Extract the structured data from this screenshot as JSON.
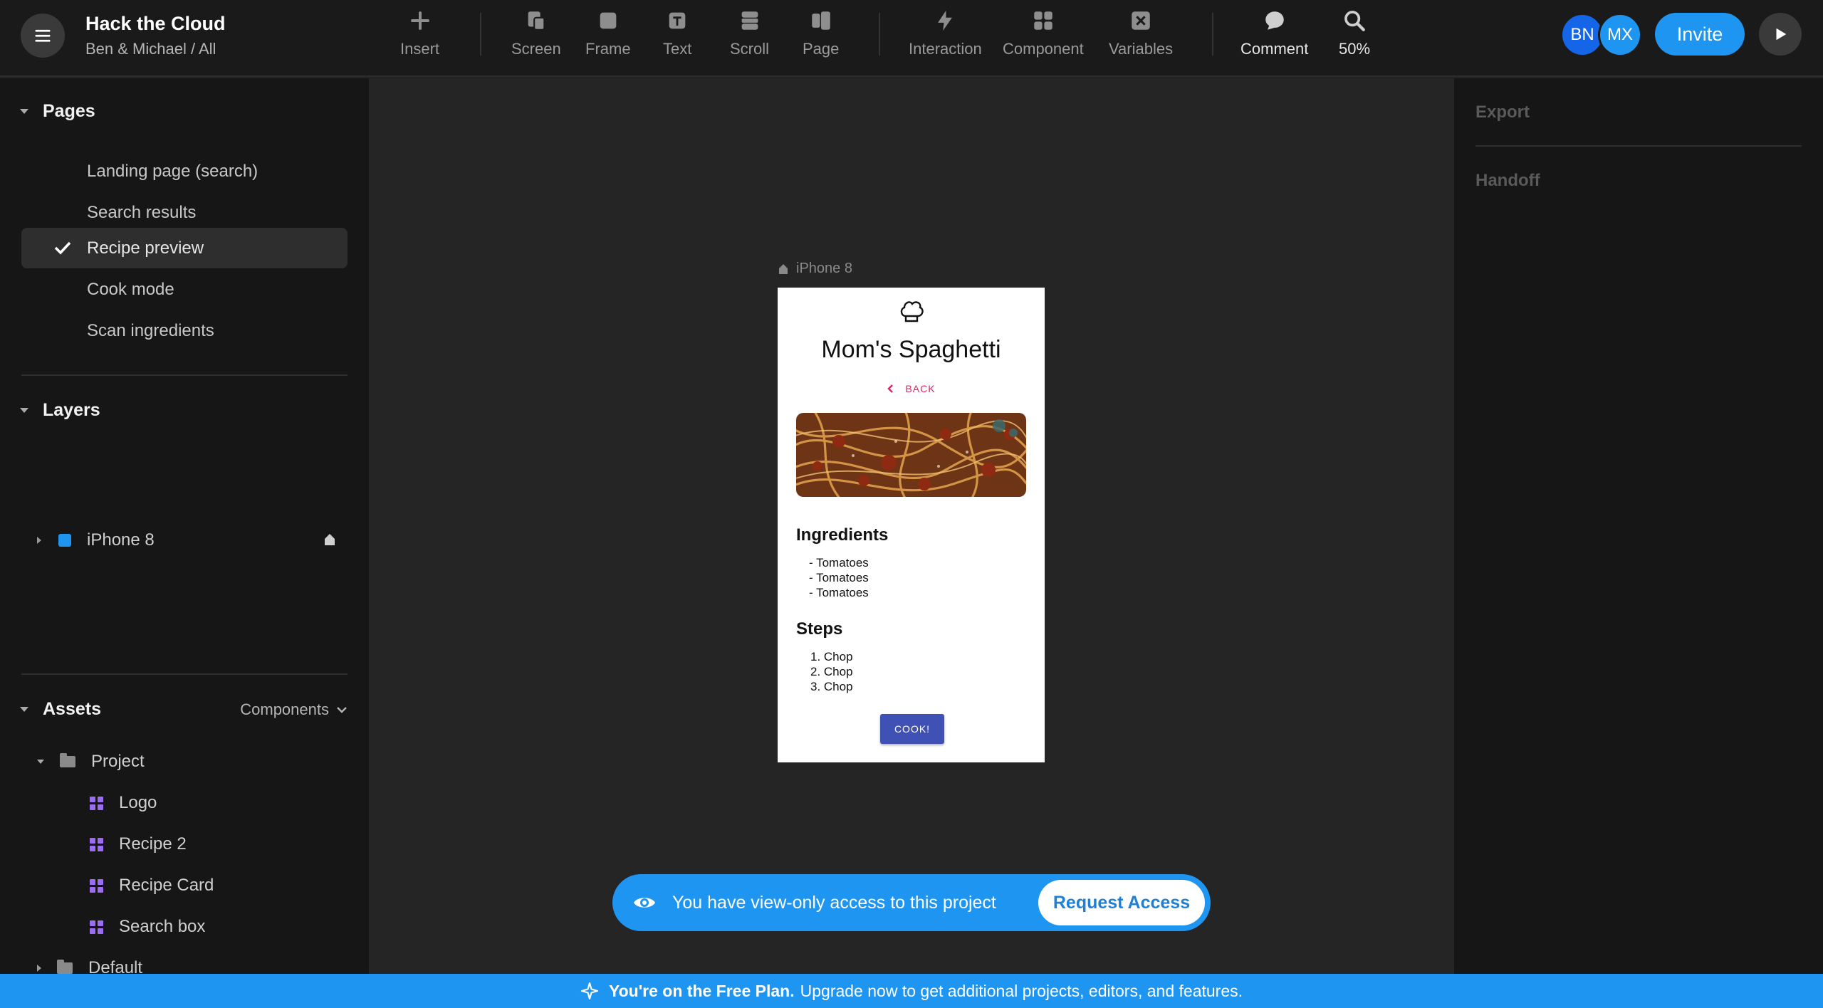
{
  "project": {
    "title": "Hack the Cloud",
    "subtitle": "Ben & Michael / All"
  },
  "toolbar": {
    "insert": "Insert",
    "screen": "Screen",
    "frame": "Frame",
    "text": "Text",
    "scroll": "Scroll",
    "page": "Page",
    "interaction": "Interaction",
    "component": "Component",
    "variables": "Variables",
    "comment": "Comment",
    "zoom": "50%"
  },
  "collaborators": [
    {
      "initials": "BN",
      "color": "#1565e8"
    },
    {
      "initials": "MX",
      "color": "#1e95f0"
    }
  ],
  "invite_label": "Invite",
  "pages": {
    "heading": "Pages",
    "items": [
      "Landing page (search)",
      "Search results",
      "Recipe preview",
      "Cook mode",
      "Scan ingredients"
    ],
    "active_index": 2
  },
  "layers": {
    "heading": "Layers",
    "items": [
      "iPhone 8"
    ]
  },
  "assets": {
    "heading": "Assets",
    "filter": "Components",
    "folders": [
      {
        "name": "Project",
        "items": [
          "Logo",
          "Recipe 2",
          "Recipe Card",
          "Search box"
        ]
      },
      {
        "name": "Default"
      }
    ]
  },
  "right_panel": {
    "export": "Export",
    "handoff": "Handoff"
  },
  "frame": {
    "name": "iPhone 8",
    "recipe": {
      "title": "Mom's Spaghetti",
      "back": "BACK",
      "ingredients_heading": "Ingredients",
      "ingredients": [
        "- Tomatoes",
        "- Tomatoes",
        "- Tomatoes"
      ],
      "steps_heading": "Steps",
      "steps": [
        "1. Chop",
        "2. Chop",
        "3. Chop"
      ],
      "cook": "COOK!"
    }
  },
  "notice": {
    "message": "You have view-only access to this project",
    "action": "Request Access"
  },
  "banner": {
    "bold": "You're on the Free Plan.",
    "text": "Upgrade now to get additional projects, editors, and features."
  },
  "colors": {
    "accent": "#1e95f0",
    "back_link": "#e0245e",
    "cook_button": "#3f51b5",
    "component_icon": "#9b6df2"
  }
}
